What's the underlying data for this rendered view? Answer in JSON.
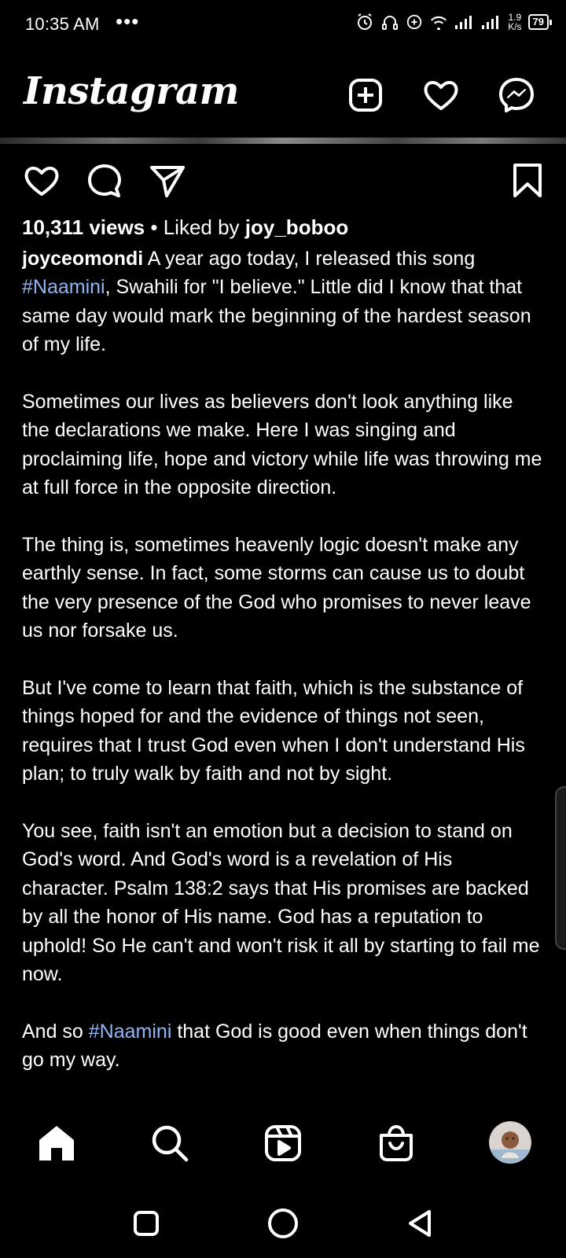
{
  "status_bar": {
    "time": "10:35 AM",
    "dots": "•••",
    "net_speed_value": "1.9",
    "net_speed_unit": "K/s",
    "battery": "79",
    "icons": [
      "alarm-icon",
      "headset-icon",
      "data-saver-icon",
      "wifi-icon",
      "signal-icon",
      "signal-icon"
    ]
  },
  "header": {
    "logo": "Instagram",
    "icons": [
      "new-post-icon",
      "heart-icon",
      "messenger-icon"
    ]
  },
  "post": {
    "views": "10,311 views",
    "separator": " • ",
    "liked_by_prefix": "Liked by ",
    "liked_by_user": "joy_boboo",
    "username": "joyceomondi",
    "caption_p1_start": " A year ago today, I released this song ",
    "hashtag_1": "#Naamini",
    "caption_p1_end": ", Swahili for \"I believe.\" Little did I know that that same day would mark the beginning of the hardest season of my life.",
    "caption_p2": "Sometimes our lives as believers don't look anything like the declarations we make. Here I was singing and proclaiming life, hope and victory while life was throwing me at full force in the opposite direction.",
    "caption_p3": "The thing is, sometimes heavenly logic doesn't make any earthly sense. In fact, some storms can cause us to doubt the very presence of the God who promises to never leave us nor forsake us.",
    "caption_p4": "But I've come to learn that faith, which is the substance of things hoped for and the evidence of things not seen, requires that I trust God even when I don't understand His plan; to truly walk by faith and not by sight.",
    "caption_p5": "You see, faith isn't an emotion but a decision to stand on God's word. And God's word is a revelation of His character. Psalm 138:2 says that His promises are backed by all the honor of His name. God has a reputation to uphold! So He can't and won't risk it all by starting to fail me now.",
    "caption_p6_start": "And so ",
    "hashtag_2": "#Naamini",
    "caption_p6_end": " that God is good even when things don't go my way.",
    "hashtag_color": "#8fb7f5"
  },
  "bottom_nav": {
    "items": [
      "home-icon",
      "search-icon",
      "reels-icon",
      "shop-icon",
      "profile-avatar"
    ]
  },
  "system_nav": {
    "items": [
      "recents-icon",
      "home-circle-icon",
      "back-icon"
    ]
  }
}
